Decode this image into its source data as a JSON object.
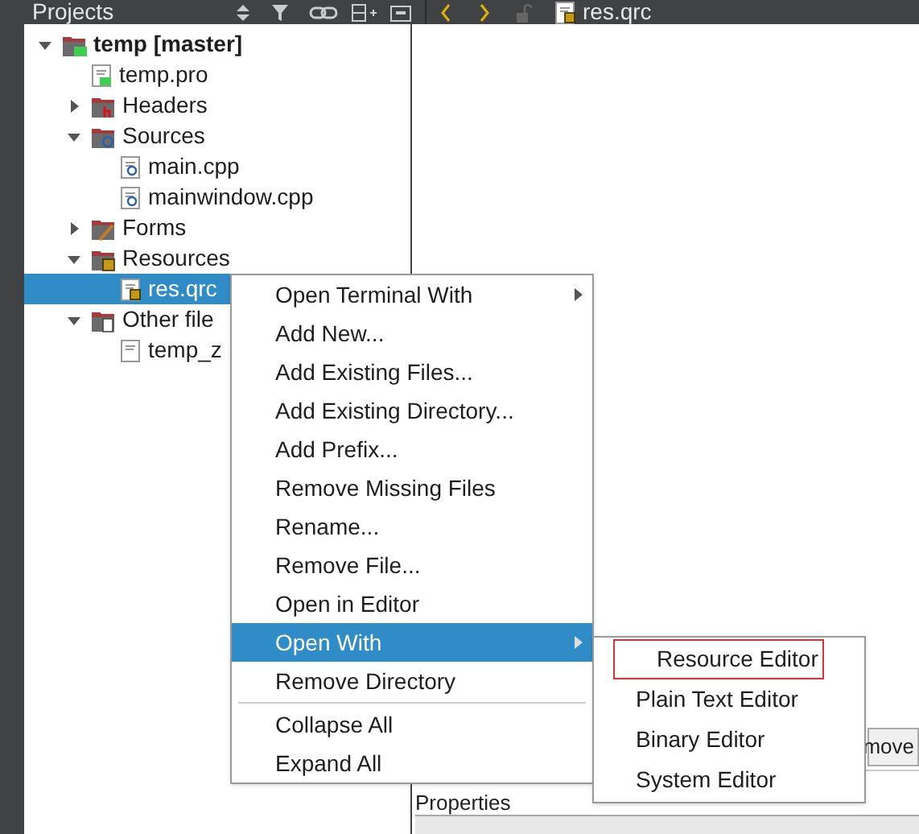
{
  "projects_pane": {
    "title": "Projects"
  },
  "editor_toolbar": {
    "file": "res.qrc"
  },
  "tree": [
    {
      "label": "temp [master]",
      "kind": "project",
      "expanded": true,
      "selected": false,
      "children": [
        {
          "label": "temp.pro",
          "kind": "pro",
          "selected": false
        },
        {
          "label": "Headers",
          "kind": "folder-headers",
          "expanded": false,
          "selected": false
        },
        {
          "label": "Sources",
          "kind": "folder-sources",
          "expanded": true,
          "selected": false,
          "children": [
            {
              "label": "main.cpp",
              "kind": "cpp",
              "selected": false
            },
            {
              "label": "mainwindow.cpp",
              "kind": "cpp",
              "selected": false
            }
          ]
        },
        {
          "label": "Forms",
          "kind": "folder-forms",
          "expanded": false,
          "selected": false
        },
        {
          "label": "Resources",
          "kind": "folder-resources",
          "expanded": true,
          "selected": false,
          "children": [
            {
              "label": "res.qrc",
              "kind": "qrc",
              "selected": true
            }
          ]
        },
        {
          "label": "Other file",
          "kind": "folder-other",
          "expanded": true,
          "selected": false,
          "children": [
            {
              "label": "temp_z",
              "kind": "text",
              "selected": false
            }
          ]
        }
      ]
    }
  ],
  "properties_label": "Properties",
  "partial_button": "move",
  "context_menu": [
    {
      "kind": "item",
      "label": "Open Terminal With",
      "submenu": true,
      "selected": false
    },
    {
      "kind": "item",
      "label": "Add New...",
      "submenu": false,
      "selected": false
    },
    {
      "kind": "item",
      "label": "Add Existing Files...",
      "submenu": false,
      "selected": false
    },
    {
      "kind": "item",
      "label": "Add Existing Directory...",
      "submenu": false,
      "selected": false
    },
    {
      "kind": "item",
      "label": "Add Prefix...",
      "submenu": false,
      "selected": false
    },
    {
      "kind": "item",
      "label": "Remove Missing Files",
      "submenu": false,
      "selected": false
    },
    {
      "kind": "item",
      "label": "Rename...",
      "submenu": false,
      "selected": false
    },
    {
      "kind": "item",
      "label": "Remove File...",
      "submenu": false,
      "selected": false
    },
    {
      "kind": "item",
      "label": "Open in Editor",
      "submenu": false,
      "selected": false
    },
    {
      "kind": "item",
      "label": "Open With",
      "submenu": true,
      "selected": true
    },
    {
      "kind": "item",
      "label": "Remove Directory",
      "submenu": false,
      "selected": false
    },
    {
      "kind": "separator"
    },
    {
      "kind": "item",
      "label": "Collapse All",
      "submenu": false,
      "selected": false
    },
    {
      "kind": "item",
      "label": "Expand All",
      "submenu": false,
      "selected": false
    }
  ],
  "open_with_menu": [
    {
      "label": "Resource Editor",
      "outlined": true
    },
    {
      "label": "Plain Text Editor",
      "outlined": false
    },
    {
      "label": "Binary Editor",
      "outlined": false
    },
    {
      "label": "System Editor",
      "outlined": false
    }
  ]
}
